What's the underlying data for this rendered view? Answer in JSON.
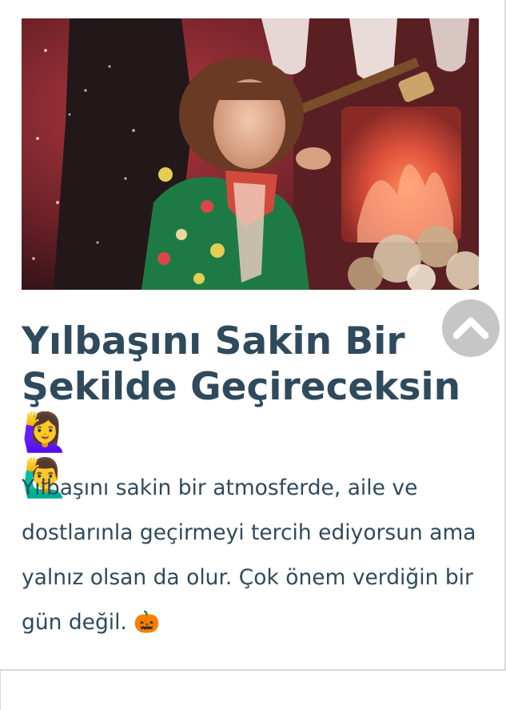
{
  "article": {
    "title": "Yılbaşını Sakin Bir Şekilde Geçireceksin",
    "title_emoji_1": "🙋‍♀️",
    "title_emoji_2": "🙋‍♂️",
    "description": "Yılbaşını sakin bir atmosferde, aile ve dostlarınla geçirmeyi tercih ediyorsun ama yalnız olsan da olur. Çok önem verdiğin bir gün değil.",
    "description_emoji": "🎃"
  },
  "scroll_top_icon": "chevron-up-icon",
  "colors": {
    "text": "#2f4a5c",
    "scroll_button": "#c6c6c6",
    "border": "#d9d9d9"
  }
}
